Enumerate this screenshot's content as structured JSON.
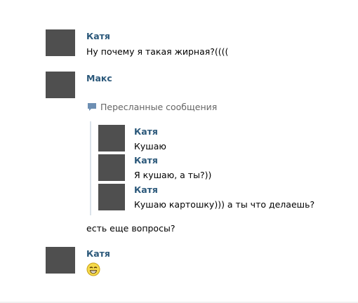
{
  "messages": [
    {
      "author": "Катя",
      "text": "Ну почему я такая жирная?(((("
    },
    {
      "author": "Макс",
      "forwarded_label": "Пересланные сообщения",
      "forwarded": [
        {
          "author": "Катя",
          "text": "Кушаю"
        },
        {
          "author": "Катя",
          "text": "Я кушаю, а ты?))"
        },
        {
          "author": "Катя",
          "text": "Кушаю картошку))) а ты что делаешь?"
        }
      ],
      "text": "есть еще вопросы?"
    },
    {
      "author": "Катя",
      "emoji": "smiley-icon"
    }
  ],
  "colors": {
    "author": "#2b587a",
    "text": "#000000",
    "muted": "#666666",
    "quote_bar": "#dbe3ea",
    "avatar_placeholder": "#4f4f4f",
    "emoji_face": "#f5d94a"
  }
}
